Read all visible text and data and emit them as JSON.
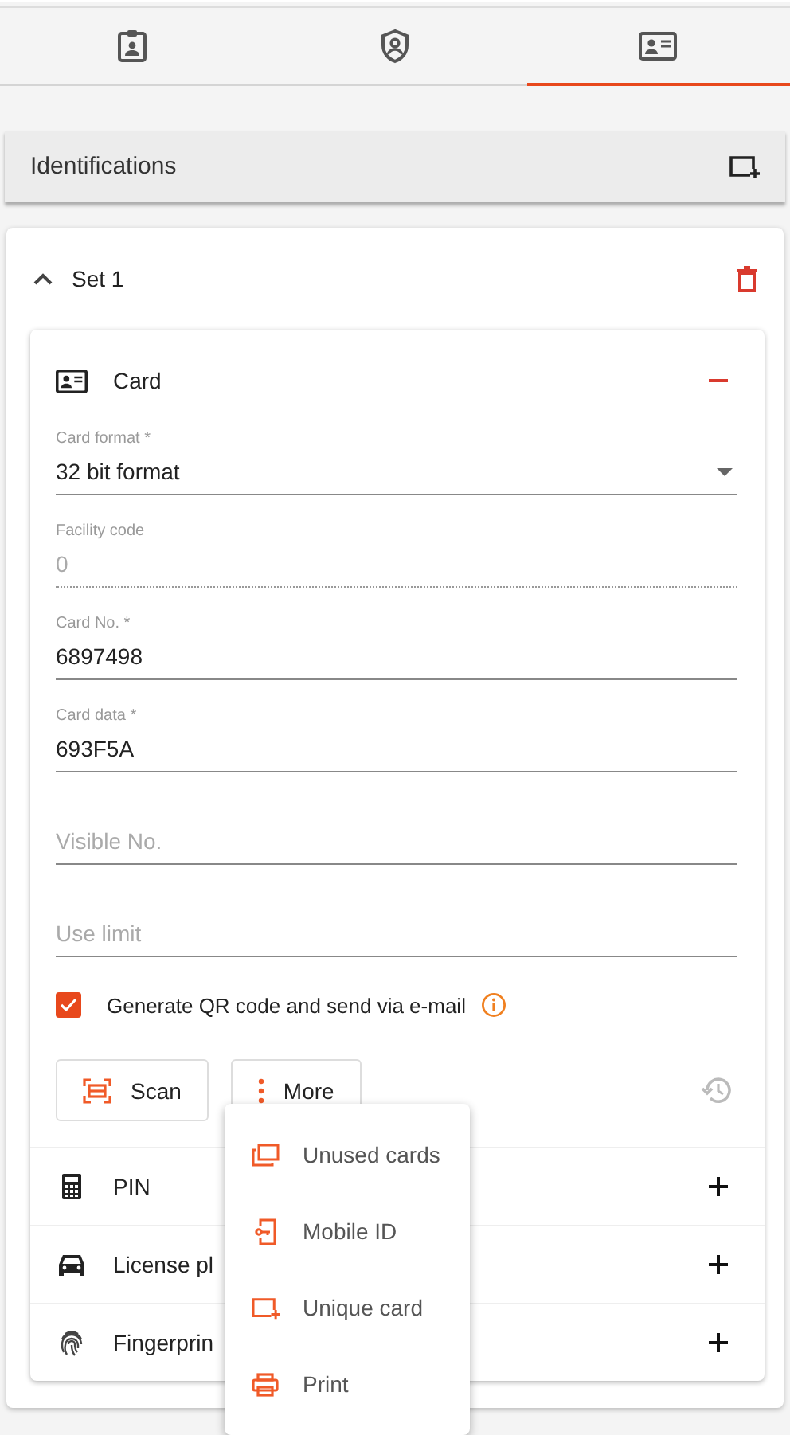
{
  "tabs": [
    {
      "kind": "badge",
      "selected": false
    },
    {
      "kind": "shield",
      "selected": false
    },
    {
      "kind": "card",
      "selected": true
    }
  ],
  "header": {
    "title": "Identifications"
  },
  "set": {
    "title": "Set 1",
    "expanded": true,
    "sections": [
      {
        "kind": "card",
        "label": "Card",
        "expanded": true
      },
      {
        "kind": "pin",
        "label": "PIN",
        "expanded": false
      },
      {
        "kind": "car",
        "label": "License pl",
        "expanded": false
      },
      {
        "kind": "fingerprint",
        "label": "Fingerprin",
        "expanded": false
      }
    ]
  },
  "fields": [
    {
      "kind": "select",
      "label": "Card format *",
      "value": "32 bit format",
      "disabled": false
    },
    {
      "kind": "text",
      "label": "Facility code",
      "value": "0",
      "disabled": true
    },
    {
      "kind": "text",
      "label": "Card No. *",
      "value": "6897498",
      "disabled": false
    },
    {
      "kind": "text",
      "label": "Card data *",
      "value": "693F5A",
      "disabled": false
    },
    {
      "kind": "text",
      "placeholder": "Visible No.",
      "disabled": false
    },
    {
      "kind": "text",
      "placeholder": "Use limit",
      "disabled": false
    }
  ],
  "qr_option": {
    "label": "Generate QR code and send via e-mail",
    "checked": true
  },
  "buttons": [
    {
      "kind": "scan",
      "label": "Scan"
    },
    {
      "kind": "more",
      "label": "More"
    }
  ],
  "menu": [
    {
      "kind": "cards",
      "label": "Unused cards"
    },
    {
      "kind": "mobile",
      "label": "Mobile ID"
    },
    {
      "kind": "addcard",
      "label": "Unique card"
    },
    {
      "kind": "print",
      "label": "Print"
    }
  ]
}
